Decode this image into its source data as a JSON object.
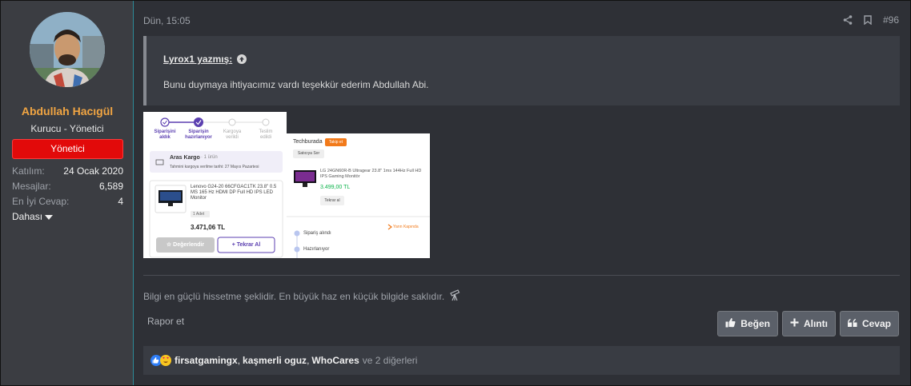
{
  "user": {
    "name": "Abdullah Hacıgül",
    "title": "Kurucu - Yönetici",
    "banner": "Yönetici",
    "stats": [
      {
        "label": "Katılım:",
        "value": "24 Ocak 2020"
      },
      {
        "label": "Mesajlar:",
        "value": "6,589"
      },
      {
        "label": "En İyi Cevap:",
        "value": "4"
      }
    ],
    "more_label": "Dahası"
  },
  "post": {
    "date": "Dün, 15:05",
    "number": "#96",
    "quote": {
      "author": "Lyrox1 yazmış:",
      "text": "Bunu duymaya ihtiyacımız vardı teşekkür ederim Abdullah Abi."
    },
    "signature": "Bilgi en güçlü hissetme şeklidir. En büyük haz en küçük bilgide saklıdır.",
    "report_label": "Rapor et",
    "actions": {
      "like": "Beğen",
      "quote": "Alıntı",
      "reply": "Cevap"
    },
    "reactions": {
      "users": [
        "firsatgamingx",
        "kaşmerli oguz",
        "WhoCares"
      ],
      "others": "ve 2 diğerleri"
    }
  },
  "attachment_1": {
    "steps": [
      "Siparişini\naldık",
      "Siparişin\nhazırlanıyor",
      "Kargoya\nverildi",
      "Teslim\nedildi"
    ],
    "carrier": "Aras Kargo",
    "carrier_count": "· 1 ürün",
    "eta": "Tahmini kargoya verilme tarihi: 27 Mayıs Pazartesi",
    "product": "Lenovo G24-20 66CFGAC1TK 23.8\" 0.5 MS 165 Hz HDMI DP Full HD IPS LED Monitor",
    "qty": "1 Adet",
    "price": "3.471,06 TL",
    "rate_btn": "Değerlendir",
    "reorder_btn": "+ Tekrar Al"
  },
  "attachment_2": {
    "seller": "Techburada",
    "badge": "Takip et",
    "ask_btn": "Satıcıya Sor",
    "product": "LG 24GN60R-B Ultragear 23.8\" 1ms 144Hz Full HD IPS Gaming Monitör",
    "price": "3.499,00 TL",
    "reorder_btn": "Tekrar al",
    "tag": "Yarın Kapında",
    "steps": [
      "Sipariş alındı",
      "Hazırlanıyor"
    ]
  },
  "colors": {
    "accent_name": "#f1a542",
    "banner": "#e20a0a",
    "sidebar_border": "#2c8a97"
  }
}
